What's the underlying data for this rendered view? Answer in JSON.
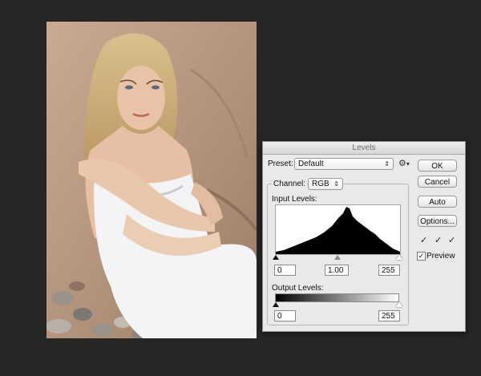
{
  "dialog": {
    "title": "Levels",
    "preset_label": "Preset:",
    "preset_value": "Default",
    "channel_label": "Channel:",
    "channel_value": "RGB",
    "input_levels_label": "Input Levels:",
    "input_black": "0",
    "input_gamma": "1.00",
    "input_white": "255",
    "output_levels_label": "Output Levels:",
    "output_black": "0",
    "output_white": "255",
    "buttons": {
      "ok": "OK",
      "cancel": "Cancel",
      "auto": "Auto",
      "options": "Options..."
    },
    "preview_label": "Preview",
    "preview_checked": true
  },
  "colors": {
    "background": "#262626",
    "dialog_bg": "#e9e9e9"
  }
}
